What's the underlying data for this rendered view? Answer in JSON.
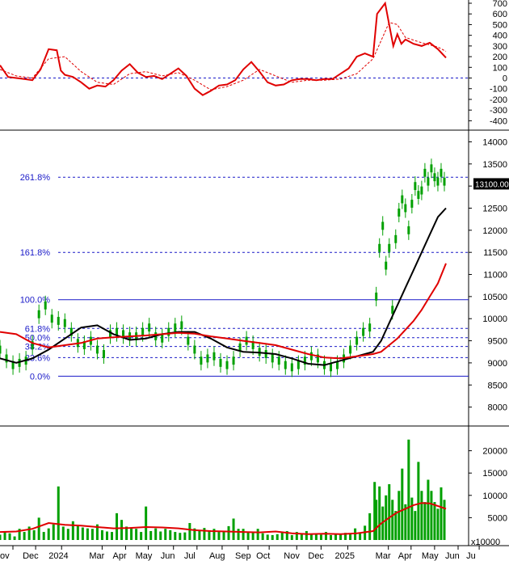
{
  "chart_data": [
    {
      "type": "line",
      "panel": "oscillator",
      "ylim": [
        -450,
        700
      ],
      "y_ticks": [
        "700",
        "600",
        "500",
        "400",
        "300",
        "200",
        "100",
        "0",
        "-100",
        "-200",
        "-300",
        "-400"
      ],
      "zero_line": 0,
      "series": [
        {
          "color": "#e00000",
          "x": [
            0,
            10,
            20,
            30,
            40,
            50,
            60,
            70,
            75,
            80,
            90,
            100,
            110,
            120,
            130,
            140,
            150,
            160,
            170,
            180,
            190,
            200,
            210,
            220,
            230,
            240,
            250,
            260,
            270,
            280,
            290,
            300,
            310,
            320,
            330,
            340,
            350,
            360,
            370,
            380,
            390,
            400,
            410,
            420,
            430,
            440,
            450,
            460,
            465,
            470,
            475,
            480,
            485,
            490,
            495,
            500,
            510,
            520,
            530,
            540,
            550
          ],
          "values": [
            120,
            10,
            0,
            -10,
            -20,
            80,
            270,
            260,
            70,
            30,
            10,
            -40,
            -100,
            -70,
            -80,
            -20,
            70,
            130,
            50,
            10,
            20,
            -10,
            40,
            90,
            20,
            -100,
            -160,
            -120,
            -70,
            -60,
            -20,
            80,
            150,
            60,
            -40,
            -70,
            -60,
            -20,
            -10,
            -10,
            -20,
            -10,
            -10,
            40,
            90,
            200,
            230,
            200,
            600,
            650,
            700,
            500,
            300,
            410,
            320,
            360,
            320,
            300,
            330,
            270,
            190
          ]
        },
        {
          "color": "#e00000",
          "dashed": true,
          "x": [
            0,
            20,
            40,
            60,
            80,
            100,
            120,
            140,
            160,
            180,
            200,
            220,
            240,
            260,
            280,
            300,
            320,
            340,
            360,
            380,
            400,
            420,
            440,
            460,
            470,
            480,
            490,
            500,
            520,
            540,
            550
          ],
          "values": [
            80,
            20,
            0,
            180,
            200,
            60,
            -40,
            -60,
            40,
            60,
            20,
            50,
            -20,
            -110,
            -80,
            -20,
            80,
            20,
            -40,
            -20,
            -20,
            -10,
            40,
            180,
            350,
            520,
            500,
            380,
            330,
            290,
            250
          ]
        }
      ]
    },
    {
      "type": "line",
      "panel": "price",
      "ylim": [
        7700,
        14100
      ],
      "y_ticks": [
        "14000",
        "13500",
        "13000",
        "12500",
        "12000",
        "11500",
        "11000",
        "10500",
        "10000",
        "9500",
        "9000",
        "8500",
        "8000"
      ],
      "price_label": "13100.00",
      "fibonacci": [
        {
          "label": "261.8%",
          "value": 13200
        },
        {
          "label": "161.8%",
          "value": 11500
        },
        {
          "label": "100.0%",
          "value": 10430
        },
        {
          "label": "61.8%",
          "value": 9780
        },
        {
          "label": "50.0%",
          "value": 9570
        },
        {
          "label": "38.2%",
          "value": 9370
        },
        {
          "label": "23.6%",
          "value": 9120
        },
        {
          "label": "0.0%",
          "value": 8700
        }
      ],
      "candles": {
        "color": "#00a000",
        "x": [
          0,
          8,
          16,
          24,
          32,
          40,
          48,
          56,
          64,
          72,
          80,
          88,
          96,
          104,
          112,
          120,
          128,
          136,
          144,
          152,
          160,
          168,
          176,
          184,
          192,
          200,
          208,
          216,
          224,
          232,
          240,
          248,
          256,
          264,
          272,
          280,
          288,
          296,
          304,
          312,
          320,
          328,
          336,
          344,
          352,
          360,
          368,
          376,
          384,
          392,
          400,
          408,
          416,
          424,
          432,
          440,
          448,
          456,
          464,
          468,
          472,
          476,
          480,
          484,
          488,
          492,
          496,
          500,
          504,
          508,
          512,
          516,
          520,
          524,
          528,
          532,
          536,
          540,
          544,
          548
        ],
        "values": [
          9300,
          9100,
          8950,
          9000,
          9050,
          9400,
          10100,
          10300,
          10000,
          9950,
          9900,
          9700,
          9450,
          9400,
          9500,
          9300,
          9200,
          9650,
          9700,
          9650,
          9600,
          9600,
          9700,
          9800,
          9600,
          9550,
          9700,
          9800,
          9850,
          9500,
          9300,
          9050,
          9100,
          9150,
          9000,
          8950,
          9050,
          9350,
          9500,
          9400,
          9250,
          9200,
          9100,
          9050,
          8950,
          8900,
          8950,
          9050,
          9150,
          9100,
          8950,
          8900,
          8950,
          9100,
          9300,
          9500,
          9700,
          9800,
          10500,
          11600,
          12100,
          11200,
          11600,
          10200,
          11800,
          12400,
          12700,
          12500,
          12000,
          12600,
          13000,
          12800,
          12900,
          13300,
          13100,
          13400,
          13200,
          13100,
          13300,
          13100
        ]
      },
      "series": [
        {
          "color": "#000000",
          "x": [
            0,
            20,
            40,
            60,
            80,
            100,
            120,
            140,
            160,
            180,
            200,
            220,
            240,
            260,
            280,
            300,
            320,
            340,
            360,
            380,
            400,
            420,
            440,
            460,
            470,
            480,
            490,
            500,
            510,
            520,
            530,
            540,
            550
          ],
          "values": [
            9100,
            9000,
            9100,
            9300,
            9550,
            9800,
            9850,
            9650,
            9520,
            9550,
            9650,
            9700,
            9700,
            9550,
            9350,
            9250,
            9230,
            9200,
            9100,
            8980,
            8950,
            9050,
            9150,
            9250,
            9500,
            9900,
            10300,
            10700,
            11100,
            11500,
            11900,
            12300,
            12500
          ]
        },
        {
          "color": "#e00000",
          "x": [
            0,
            20,
            40,
            60,
            80,
            100,
            120,
            140,
            160,
            180,
            200,
            220,
            240,
            260,
            280,
            300,
            320,
            340,
            360,
            380,
            400,
            420,
            440,
            460,
            470,
            480,
            490,
            500,
            510,
            520,
            530,
            540,
            550
          ],
          "values": [
            9700,
            9650,
            9450,
            9350,
            9400,
            9450,
            9550,
            9580,
            9600,
            9620,
            9650,
            9680,
            9660,
            9600,
            9550,
            9500,
            9450,
            9400,
            9300,
            9200,
            9120,
            9100,
            9150,
            9200,
            9250,
            9400,
            9550,
            9750,
            9950,
            10200,
            10500,
            10800,
            11250
          ]
        }
      ]
    },
    {
      "type": "bar",
      "panel": "volume",
      "ylim": [
        0,
        25000
      ],
      "y_ticks": [
        "20000",
        "15000",
        "10000",
        "5000"
      ],
      "unit_label": "x10000",
      "bars": {
        "color": "#00a000",
        "x": [
          0,
          6,
          12,
          18,
          24,
          30,
          36,
          42,
          48,
          54,
          60,
          66,
          72,
          78,
          84,
          90,
          96,
          102,
          108,
          114,
          120,
          126,
          132,
          138,
          144,
          150,
          156,
          162,
          168,
          174,
          180,
          186,
          192,
          198,
          204,
          210,
          216,
          222,
          228,
          234,
          240,
          246,
          252,
          258,
          264,
          270,
          276,
          282,
          288,
          294,
          300,
          306,
          312,
          318,
          324,
          330,
          336,
          342,
          348,
          354,
          360,
          366,
          372,
          378,
          384,
          390,
          396,
          402,
          408,
          414,
          420,
          426,
          432,
          438,
          444,
          450,
          456,
          462,
          464,
          468,
          472,
          476,
          480,
          484,
          488,
          492,
          496,
          500,
          504,
          508,
          512,
          516,
          520,
          524,
          528,
          532,
          536,
          540,
          544,
          548
        ],
        "values": [
          1200,
          2000,
          1500,
          800,
          2500,
          1800,
          3000,
          2200,
          5000,
          1800,
          2600,
          3500,
          12000,
          3000,
          2500,
          4200,
          3200,
          2800,
          2600,
          2500,
          3500,
          2200,
          1900,
          1800,
          6000,
          4500,
          3000,
          2700,
          2500,
          1800,
          7500,
          2000,
          2600,
          1900,
          2500,
          2200,
          1800,
          1600,
          1700,
          3800,
          2600,
          2000,
          2700,
          1900,
          2500,
          1800,
          1800,
          3100,
          4800,
          2500,
          2500,
          1900,
          1700,
          2500,
          1500,
          1200,
          1100,
          1300,
          1900,
          2000,
          1100,
          1800,
          1500,
          2000,
          1300,
          1200,
          1200,
          1800,
          1100,
          1300,
          1300,
          1600,
          1500,
          2600,
          1500,
          3200,
          6000,
          13000,
          9000,
          12000,
          7500,
          10000,
          12500,
          9000,
          6500,
          11000,
          16000,
          8000,
          22500,
          9500,
          6500,
          17500,
          11000,
          8500,
          13500,
          11000,
          8500,
          7000,
          11800,
          9000
        ]
      },
      "series": [
        {
          "color": "#e00000",
          "x": [
            0,
            20,
            40,
            60,
            80,
            100,
            120,
            140,
            160,
            180,
            200,
            220,
            240,
            260,
            280,
            300,
            320,
            340,
            360,
            380,
            400,
            420,
            440,
            460,
            470,
            480,
            490,
            500,
            510,
            520,
            530,
            540,
            550
          ],
          "values": [
            1800,
            1900,
            2500,
            3800,
            3400,
            3200,
            2900,
            2600,
            2700,
            2900,
            2800,
            2600,
            2200,
            2000,
            1900,
            1800,
            1700,
            1900,
            1500,
            1300,
            1400,
            1300,
            1500,
            2000,
            3700,
            5000,
            6200,
            7000,
            7800,
            8300,
            8200,
            7600,
            7000
          ]
        }
      ]
    },
    {
      "type": "table",
      "panel": "x-axis",
      "x_ticks": [
        {
          "label": "ov",
          "x": 0
        },
        {
          "label": "Dec",
          "x": 28
        },
        {
          "label": "2024",
          "x": 60
        },
        {
          "label": "Mar",
          "x": 110
        },
        {
          "label": "Apr",
          "x": 139
        },
        {
          "label": "May",
          "x": 167
        },
        {
          "label": "Jun",
          "x": 198
        },
        {
          "label": "Jul",
          "x": 227
        },
        {
          "label": "Aug",
          "x": 258
        },
        {
          "label": "Sep",
          "x": 290
        },
        {
          "label": "Oct",
          "x": 316
        },
        {
          "label": "Nov",
          "x": 350
        },
        {
          "label": "Dec",
          "x": 380
        },
        {
          "label": "2025",
          "x": 413
        },
        {
          "label": "Mar",
          "x": 463
        },
        {
          "label": "Apr",
          "x": 491
        },
        {
          "label": "May",
          "x": 520
        },
        {
          "label": "Jun",
          "x": 549
        },
        {
          "label": "Ju",
          "x": 575
        }
      ]
    }
  ]
}
